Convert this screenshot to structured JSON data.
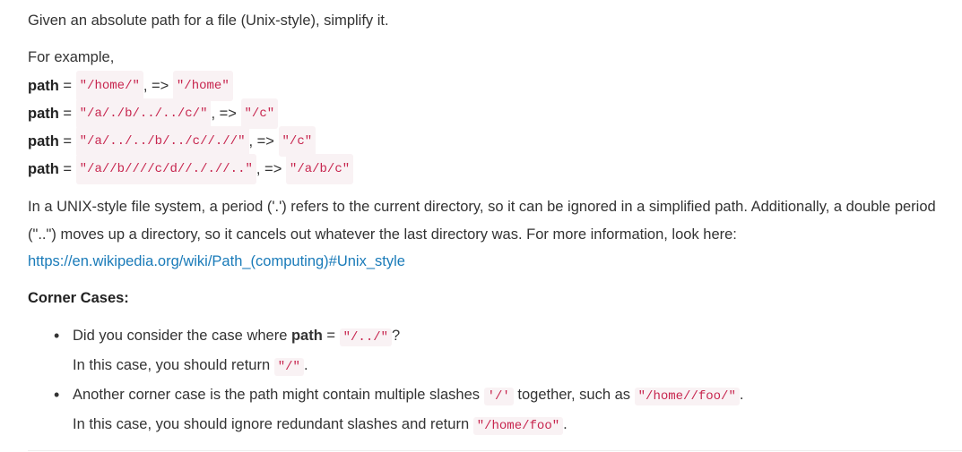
{
  "intro": "Given an absolute path for a file (Unix-style), simplify it.",
  "for_example": "For example,",
  "examples": [
    {
      "label": "path",
      "eq": " = ",
      "input": "\"/home/\"",
      "arrow": ", => ",
      "output": "\"/home\""
    },
    {
      "label": "path",
      "eq": " = ",
      "input": "\"/a/./b/../../c/\"",
      "arrow": ", => ",
      "output": "\"/c\""
    },
    {
      "label": "path",
      "eq": " = ",
      "input": "\"/a/../../b/../c//.//\"",
      "arrow": ", => ",
      "output": "\"/c\""
    },
    {
      "label": "path",
      "eq": " = ",
      "input": "\"/a//b////c/d//././/..\"",
      "arrow": ", => ",
      "output": "\"/a/b/c\""
    }
  ],
  "paragraph": {
    "text1": "In a UNIX-style file system, a period ('.') refers to the current directory, so it can be ignored in a simplified path. Additionally, a double period (\"..\") moves up a directory, so it cancels out whatever the last directory was. For more information, look here: ",
    "link": "https://en.wikipedia.org/wiki/Path_(computing)#Unix_style"
  },
  "corner_title": "Corner Cases:",
  "corner": [
    {
      "t1": "Did you consider the case where ",
      "bold": "path",
      "t2": " = ",
      "code": "\"/../\"",
      "t3": "?",
      "s1": "In this case, you should return ",
      "scode": "\"/\"",
      "s2": "."
    },
    {
      "t1": "Another corner case is the path might contain multiple slashes ",
      "code": "'/'",
      "t2": " together, such as ",
      "code2": "\"/home//foo/\"",
      "t3": ".",
      "s1": "In this case, you should ignore redundant slashes and return ",
      "scode": "\"/home/foo\"",
      "s2": "."
    }
  ]
}
